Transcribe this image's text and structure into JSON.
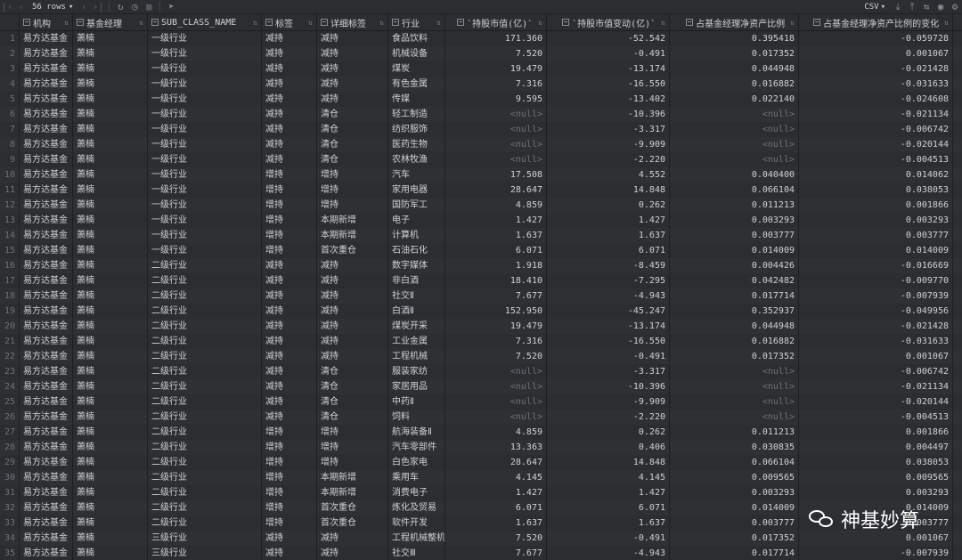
{
  "toolbar": {
    "rows_label": "56 rows",
    "export_format": "CSV"
  },
  "columns": [
    {
      "label": "",
      "numeric": false,
      "icon": false
    },
    {
      "label": "机构",
      "numeric": false,
      "icon": true
    },
    {
      "label": "基金经理",
      "numeric": false,
      "icon": true
    },
    {
      "label": "SUB_CLASS_NAME",
      "numeric": false,
      "icon": true
    },
    {
      "label": "标签",
      "numeric": false,
      "icon": true
    },
    {
      "label": "详细标签",
      "numeric": false,
      "icon": true
    },
    {
      "label": "行业",
      "numeric": false,
      "icon": true
    },
    {
      "label": "`持股市值(亿)`",
      "numeric": true,
      "icon": true
    },
    {
      "label": "`持股市值变动(亿)`",
      "numeric": true,
      "icon": true
    },
    {
      "label": "占基金经理净资产比例",
      "numeric": true,
      "icon": true
    },
    {
      "label": "占基金经理净资产比例的变化",
      "numeric": true,
      "icon": true
    }
  ],
  "rows": [
    [
      "1",
      "易方达基金",
      "萧楠",
      "一级行业",
      "减持",
      "减持",
      "食品饮料",
      "171.360",
      "-52.542",
      "0.395418",
      "-0.059728"
    ],
    [
      "2",
      "易方达基金",
      "萧楠",
      "一级行业",
      "减持",
      "减持",
      "机械设备",
      "7.520",
      "-0.491",
      "0.017352",
      "0.001067"
    ],
    [
      "3",
      "易方达基金",
      "萧楠",
      "一级行业",
      "减持",
      "减持",
      "煤炭",
      "19.479",
      "-13.174",
      "0.044948",
      "-0.021428"
    ],
    [
      "4",
      "易方达基金",
      "萧楠",
      "一级行业",
      "减持",
      "减持",
      "有色金属",
      "7.316",
      "-16.550",
      "0.016882",
      "-0.031633"
    ],
    [
      "5",
      "易方达基金",
      "萧楠",
      "一级行业",
      "减持",
      "减持",
      "传媒",
      "9.595",
      "-13.402",
      "0.022140",
      "-0.024608"
    ],
    [
      "6",
      "易方达基金",
      "萧楠",
      "一级行业",
      "减持",
      "清仓",
      "轻工制造",
      "<null>",
      "-10.396",
      "<null>",
      "-0.021134"
    ],
    [
      "7",
      "易方达基金",
      "萧楠",
      "一级行业",
      "减持",
      "清仓",
      "纺织服饰",
      "<null>",
      "-3.317",
      "<null>",
      "-0.006742"
    ],
    [
      "8",
      "易方达基金",
      "萧楠",
      "一级行业",
      "减持",
      "清仓",
      "医药生物",
      "<null>",
      "-9.909",
      "<null>",
      "-0.020144"
    ],
    [
      "9",
      "易方达基金",
      "萧楠",
      "一级行业",
      "减持",
      "清仓",
      "农林牧渔",
      "<null>",
      "-2.220",
      "<null>",
      "-0.004513"
    ],
    [
      "10",
      "易方达基金",
      "萧楠",
      "一级行业",
      "增持",
      "增持",
      "汽车",
      "17.508",
      "4.552",
      "0.040400",
      "0.014062"
    ],
    [
      "11",
      "易方达基金",
      "萧楠",
      "一级行业",
      "增持",
      "增持",
      "家用电器",
      "28.647",
      "14.848",
      "0.066104",
      "0.038053"
    ],
    [
      "12",
      "易方达基金",
      "萧楠",
      "一级行业",
      "增持",
      "增持",
      "国防军工",
      "4.859",
      "0.262",
      "0.011213",
      "0.001866"
    ],
    [
      "13",
      "易方达基金",
      "萧楠",
      "一级行业",
      "增持",
      "本期新增",
      "电子",
      "1.427",
      "1.427",
      "0.003293",
      "0.003293"
    ],
    [
      "14",
      "易方达基金",
      "萧楠",
      "一级行业",
      "增持",
      "本期新增",
      "计算机",
      "1.637",
      "1.637",
      "0.003777",
      "0.003777"
    ],
    [
      "15",
      "易方达基金",
      "萧楠",
      "一级行业",
      "增持",
      "首次重仓",
      "石油石化",
      "6.071",
      "6.071",
      "0.014009",
      "0.014009"
    ],
    [
      "16",
      "易方达基金",
      "萧楠",
      "二级行业",
      "减持",
      "减持",
      "数字媒体",
      "1.918",
      "-8.459",
      "0.004426",
      "-0.016669"
    ],
    [
      "17",
      "易方达基金",
      "萧楠",
      "二级行业",
      "减持",
      "减持",
      "非白酒",
      "18.410",
      "-7.295",
      "0.042482",
      "-0.009770"
    ],
    [
      "18",
      "易方达基金",
      "萧楠",
      "二级行业",
      "减持",
      "减持",
      "社交Ⅱ",
      "7.677",
      "-4.943",
      "0.017714",
      "-0.007939"
    ],
    [
      "19",
      "易方达基金",
      "萧楠",
      "二级行业",
      "减持",
      "减持",
      "白酒Ⅱ",
      "152.950",
      "-45.247",
      "0.352937",
      "-0.049956"
    ],
    [
      "20",
      "易方达基金",
      "萧楠",
      "二级行业",
      "减持",
      "减持",
      "煤炭开采",
      "19.479",
      "-13.174",
      "0.044948",
      "-0.021428"
    ],
    [
      "21",
      "易方达基金",
      "萧楠",
      "二级行业",
      "减持",
      "减持",
      "工业金属",
      "7.316",
      "-16.550",
      "0.016882",
      "-0.031633"
    ],
    [
      "22",
      "易方达基金",
      "萧楠",
      "二级行业",
      "减持",
      "减持",
      "工程机械",
      "7.520",
      "-0.491",
      "0.017352",
      "0.001067"
    ],
    [
      "23",
      "易方达基金",
      "萧楠",
      "二级行业",
      "减持",
      "清仓",
      "服装家纺",
      "<null>",
      "-3.317",
      "<null>",
      "-0.006742"
    ],
    [
      "24",
      "易方达基金",
      "萧楠",
      "二级行业",
      "减持",
      "清仓",
      "家居用品",
      "<null>",
      "-10.396",
      "<null>",
      "-0.021134"
    ],
    [
      "25",
      "易方达基金",
      "萧楠",
      "二级行业",
      "减持",
      "清仓",
      "中药Ⅱ",
      "<null>",
      "-9.909",
      "<null>",
      "-0.020144"
    ],
    [
      "26",
      "易方达基金",
      "萧楠",
      "二级行业",
      "减持",
      "清仓",
      "饲料",
      "<null>",
      "-2.220",
      "<null>",
      "-0.004513"
    ],
    [
      "27",
      "易方达基金",
      "萧楠",
      "二级行业",
      "增持",
      "增持",
      "航海装备Ⅱ",
      "4.859",
      "0.262",
      "0.011213",
      "0.001866"
    ],
    [
      "28",
      "易方达基金",
      "萧楠",
      "二级行业",
      "增持",
      "增持",
      "汽车零部件",
      "13.363",
      "0.406",
      "0.030835",
      "0.004497"
    ],
    [
      "29",
      "易方达基金",
      "萧楠",
      "二级行业",
      "增持",
      "增持",
      "白色家电",
      "28.647",
      "14.848",
      "0.066104",
      "0.038053"
    ],
    [
      "30",
      "易方达基金",
      "萧楠",
      "二级行业",
      "增持",
      "本期新增",
      "乘用车",
      "4.145",
      "4.145",
      "0.009565",
      "0.009565"
    ],
    [
      "31",
      "易方达基金",
      "萧楠",
      "二级行业",
      "增持",
      "本期新增",
      "消费电子",
      "1.427",
      "1.427",
      "0.003293",
      "0.003293"
    ],
    [
      "32",
      "易方达基金",
      "萧楠",
      "二级行业",
      "增持",
      "首次重仓",
      "炼化及贸易",
      "6.071",
      "6.071",
      "0.014009",
      "0.014009"
    ],
    [
      "33",
      "易方达基金",
      "萧楠",
      "二级行业",
      "增持",
      "首次重仓",
      "软件开发",
      "1.637",
      "1.637",
      "0.003777",
      "0.003777"
    ],
    [
      "34",
      "易方达基金",
      "萧楠",
      "三级行业",
      "减持",
      "减持",
      "工程机械整机",
      "7.520",
      "-0.491",
      "0.017352",
      "0.001067"
    ],
    [
      "35",
      "易方达基金",
      "萧楠",
      "三级行业",
      "减持",
      "减持",
      "社交Ⅲ",
      "7.677",
      "-4.943",
      "0.017714",
      "-0.007939"
    ]
  ],
  "watermark": {
    "text": "神基妙算",
    "logo": "wechat-logo"
  }
}
